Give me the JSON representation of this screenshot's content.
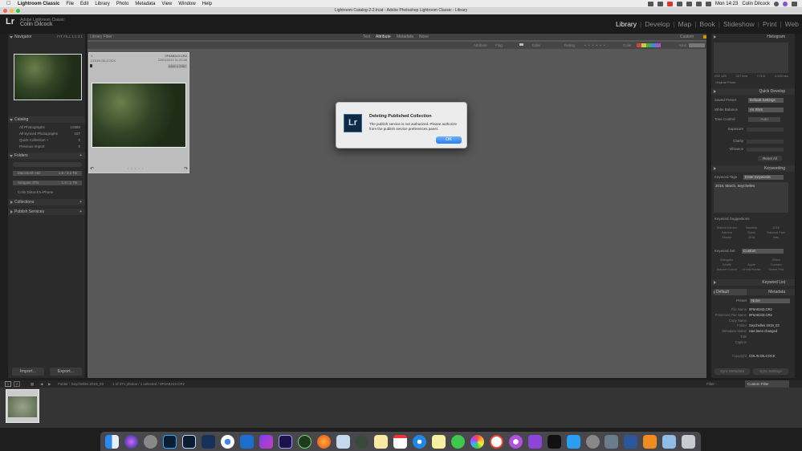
{
  "menubar": {
    "apple": "",
    "items": [
      "Lightroom Classic",
      "File",
      "Edit",
      "Library",
      "Photo",
      "Metadata",
      "View",
      "Window",
      "Help"
    ],
    "clock": "Mon 14:23",
    "user": "Colin Dilcock"
  },
  "window": {
    "title": "Lightroom Catalog-2-2.lrcat - Adobe Photoshop Lightroom Classic - Library"
  },
  "identity": {
    "logo": "Lr",
    "product": "Adobe Lightroom Classic",
    "user": "Colin Dilcock"
  },
  "modules": [
    "Library",
    "Develop",
    "Map",
    "Book",
    "Slideshow",
    "Print",
    "Web"
  ],
  "left_panel": {
    "navigator": {
      "title": "Navigator",
      "zoom": [
        "FIT",
        "FILL",
        "1:1",
        "3:1"
      ]
    },
    "catalog": {
      "title": "Catalog",
      "items": [
        {
          "label": "All Photographs",
          "count": "10360"
        },
        {
          "label": "All Synced Photographs",
          "count": "107"
        },
        {
          "label": "Quick Collection +",
          "count": "0"
        },
        {
          "label": "Previous Import",
          "count": "0"
        }
      ]
    },
    "folders": {
      "title": "Folders",
      "volumes": [
        {
          "label": "Macintosh HD",
          "info": "1.6 / 3.1 TB"
        },
        {
          "label": "Seagate 3TB",
          "info": "1.8 / 2 TB"
        },
        {
          "label": "Colin Dilcock's iPhone",
          "info": ""
        }
      ]
    },
    "collections": {
      "title": "Collections"
    },
    "publish": {
      "title": "Publish Services"
    },
    "import_label": "Import...",
    "export_label": "Export..."
  },
  "filter_bar": {
    "title": "Library Filter :",
    "tabs": [
      "Text",
      "Attribute",
      "Metadata",
      "None"
    ],
    "preset": "Custom"
  },
  "attribute_bar": {
    "label": "Attribute",
    "flag": "Flag",
    "edits": "Edits",
    "rating": "Rating",
    "color": "Color",
    "kind": "Kind"
  },
  "thumbnail": {
    "index": "1",
    "filename": "0F6A8243.CR2",
    "owner": "COLIN DILCOCK",
    "date": "22/03/2019 11:20:46",
    "dims": "4480 x 2987"
  },
  "dialog": {
    "title": "Deleting Published Collection",
    "message": "The publish service is not authorized. Please authorize from the publish service preferences panel.",
    "ok": "OK",
    "icon": "Lr"
  },
  "right_panel": {
    "histogram": {
      "title": "Histogram",
      "iso": "ISO 125",
      "focal": "227 mm",
      "aperture": "f / 5.6",
      "shutter": "1/125 sec",
      "original": "Original Photo"
    },
    "quick_develop": {
      "title": "Quick Develop",
      "saved_preset": "Saved Preset",
      "saved_preset_value": "Default Settings",
      "white_balance": "White Balance",
      "white_balance_value": "As Shot",
      "tone_control": "Tone Control",
      "auto": "Auto",
      "exposure": "Exposure",
      "clarity": "Clarity",
      "vibrance": "Vibrance",
      "reset": "Reset All"
    },
    "keywording": {
      "title": "Keywording",
      "tags_label": "Keyword Tags",
      "tags_value": "Enter Keywords",
      "tags": "2019, March, Seychelles",
      "suggestions_title": "Keyword Suggestions",
      "suggestions": [
        "Walled Garden",
        "Namibia",
        "2018",
        "Sabrina",
        "Spain",
        "National Park",
        "Etosha",
        "2018",
        "Italy"
      ],
      "set_label": "Keyword Set",
      "set_value": "Custom",
      "set_items": [
        "Mangaler",
        "",
        "Zebra",
        "Giraffe",
        "Apple",
        "Orchard",
        "Autumn Colour",
        "Orchid House",
        "Sweet Pea"
      ]
    },
    "keyword_list": {
      "title": "Keyword List"
    },
    "metadata": {
      "title": "Metadata",
      "preset_label": "Default",
      "preset": "Preset",
      "preset_value": "None",
      "fields": [
        {
          "label": "File Name",
          "value": "0F6A8243.CR2"
        },
        {
          "label": "Preserved File Name",
          "value": "0F6A8243.CR2"
        },
        {
          "label": "Copy Name",
          "value": ""
        },
        {
          "label": "Folder",
          "value": "Seychelles 2019_03"
        },
        {
          "label": "Metadata Status",
          "value": "Has been changed"
        },
        {
          "label": "Title",
          "value": ""
        },
        {
          "label": "Caption",
          "value": ""
        },
        {
          "label": "Copyright",
          "value": "COLIN DILCOCK"
        }
      ]
    },
    "sync_metadata": "Sync Metadata",
    "sync_settings": "Sync Settings"
  },
  "bottom_bar": {
    "pages": [
      "1",
      "2"
    ],
    "path": "Folder : Seychelles 2019_03",
    "status": "1 of 371 photos / 1 selected / 0F6A8243.CR2",
    "filter_label": "Filter :",
    "filter_value": "Custom Filter"
  },
  "dock": {
    "items": [
      "Finder",
      "Siri",
      "Launchpad",
      "Photoshop",
      "Lightroom",
      "Bridge",
      "Chrome",
      "Safari Technology",
      "Affinity",
      "Premiere",
      "Dragon",
      "Firefox",
      "Preview",
      "Time Machine",
      "Notes",
      "Calendar",
      "Safari",
      "Stickies",
      "Messages",
      "Photos",
      "iTunes",
      "News",
      "Podcasts",
      "Apple TV",
      "App Store",
      "System Preferences",
      "Image Capture",
      "Word",
      "Home",
      "Downloads",
      "Trash"
    ]
  },
  "colors": {
    "accent": "#2a7ef1",
    "bg": "#1e1e1e",
    "panel": "#2b2b2b",
    "center": "#585858"
  }
}
